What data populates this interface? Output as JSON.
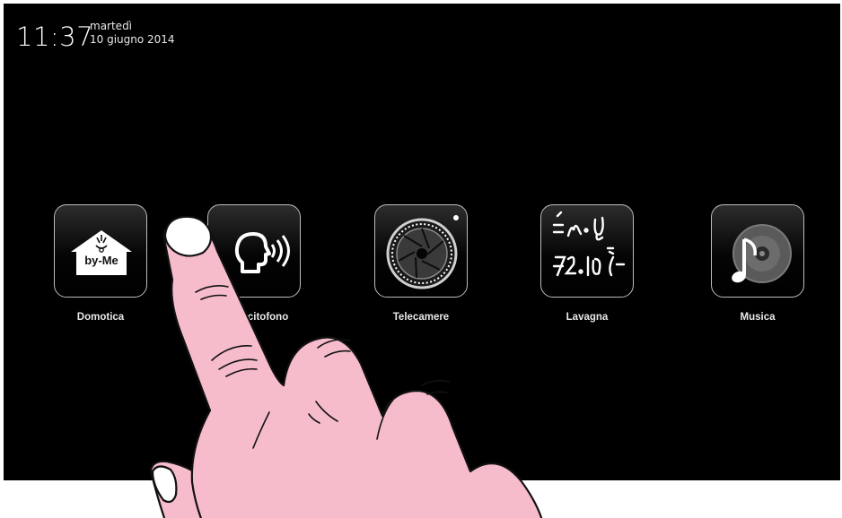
{
  "status": {
    "time": "11:37",
    "weekday": "martedì",
    "date": "10 giugno 2014"
  },
  "apps": [
    {
      "label": "Domotica",
      "icon": "house-byme-icon",
      "brand": "by-Me"
    },
    {
      "label": "Videocitofono",
      "icon": "speaking-head-icon"
    },
    {
      "label": "Telecamere",
      "icon": "camera-lens-icon"
    },
    {
      "label": "Lavagna",
      "icon": "chalkboard-icon"
    },
    {
      "label": "Musica",
      "icon": "music-disc-icon"
    }
  ],
  "overlay": {
    "icon": "pointing-hand-icon"
  }
}
